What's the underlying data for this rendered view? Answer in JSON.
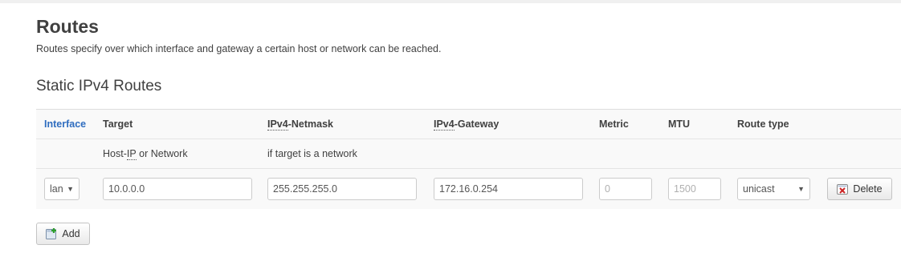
{
  "page": {
    "title": "Routes",
    "description": "Routes specify over which interface and gateway a certain host or network can be reached."
  },
  "section": {
    "title": "Static IPv4 Routes"
  },
  "table": {
    "headers": {
      "interface": "Interface",
      "target": "Target",
      "netmask_abbr": "IPv4",
      "netmask_rest": "-Netmask",
      "gateway_abbr": "IPv4",
      "gateway_rest": "-Gateway",
      "metric": "Metric",
      "mtu": "MTU",
      "route_type": "Route type"
    },
    "descriptions": {
      "target_prefix": "Host-",
      "target_abbr": "IP",
      "target_suffix": " or Network",
      "netmask": "if target is a network"
    },
    "row": {
      "interface": "lan",
      "target": "10.0.0.0",
      "netmask": "255.255.255.0",
      "gateway": "172.16.0.254",
      "metric_placeholder": "0",
      "mtu_placeholder": "1500",
      "route_type": "unicast",
      "delete_label": "Delete"
    }
  },
  "actions": {
    "add_label": "Add"
  },
  "colors": {
    "link": "#2f6dbf",
    "table_bg": "#f9f9f9",
    "delete_icon": "#cc2222"
  },
  "icons": {
    "delete": "delete-icon",
    "add": "add-icon",
    "dropdown": "chevron-down-icon"
  }
}
